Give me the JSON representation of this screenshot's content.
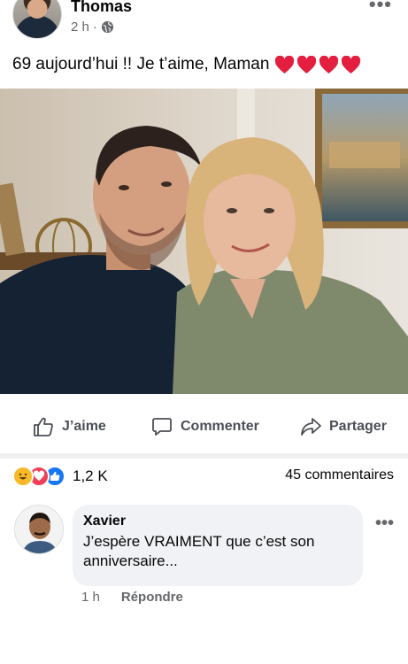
{
  "post": {
    "author": "Thomas",
    "time": "2 h",
    "separator": "·",
    "privacy_icon": "globe-icon",
    "more_icon": "•••",
    "text": "69 aujourd’hui !! Je t’aime, Maman",
    "hearts": [
      "heart-icon",
      "heart-icon",
      "heart-icon",
      "heart-icon"
    ]
  },
  "actions": {
    "like": "J’aime",
    "comment": "Commenter",
    "share": "Partager"
  },
  "stats": {
    "reactions": [
      "haha",
      "love",
      "like"
    ],
    "reaction_count": "1,2 K",
    "comments_count": "45 commentaires"
  },
  "comment": {
    "author": "Xavier",
    "text": "J’espère VRAIMENT que c’est son anniversaire...",
    "time": "1 h",
    "reply": "Répondre",
    "more_icon": "•••"
  },
  "colors": {
    "text_primary": "#050505",
    "text_secondary": "#65676b",
    "heart_red": "#e41e3f",
    "like_blue": "#1877f2",
    "bubble_bg": "#f0f2f5"
  }
}
